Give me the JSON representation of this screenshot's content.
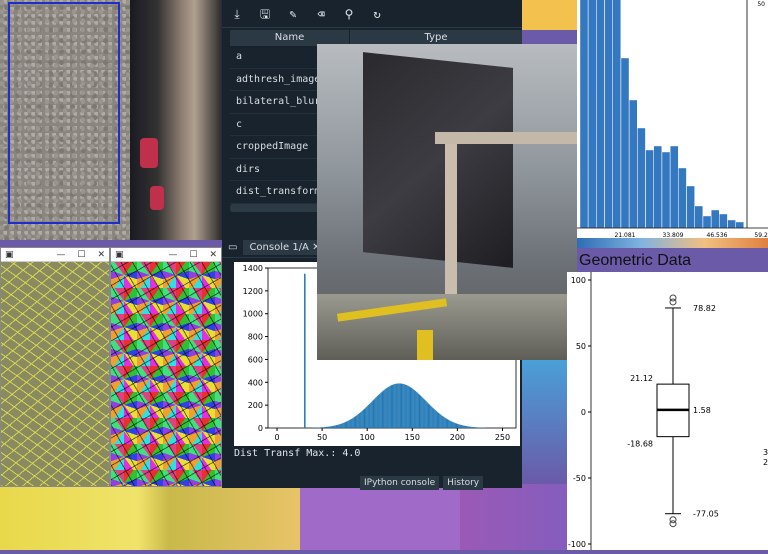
{
  "spyder": {
    "variable_explorer": {
      "col_name": "Name",
      "col_type": "Type",
      "rows": [
        "a",
        "adthresh_image",
        "bilateral_blur_",
        "c",
        "croppedImage",
        "dirs",
        "dist_transform"
      ]
    },
    "console_tab": "Console 1/A",
    "dist_text": "Dist Transf Max.:  4.0",
    "bottom_tabs": [
      "IPython console",
      "History"
    ]
  },
  "console_hist": {
    "type": "bar",
    "ytick_labels": [
      "1400",
      "1200",
      "1000",
      "800",
      "600",
      "400",
      "200",
      "0"
    ],
    "xtick_labels": [
      "0",
      "50",
      "100",
      "150",
      "200",
      "250"
    ],
    "spike_x": 30,
    "spike_y": 1350,
    "xlim": [
      -10,
      265
    ],
    "ylim": [
      0,
      1400
    ]
  },
  "right_hist": {
    "xtick_labels": [
      "21.081",
      "33.809",
      "46.536",
      "59.26"
    ],
    "right_tick": "50"
  },
  "geometric": {
    "title": "Geometric Data",
    "ytick_labels": [
      "100",
      "50",
      "0",
      "-50",
      "-100"
    ],
    "annotations": {
      "upper_whisker": "78.82",
      "q3": "21.12",
      "median": "1.58",
      "q1": "-18.68",
      "lower_whisker": "-77.05"
    },
    "clipped_right": [
      "3",
      "2"
    ]
  },
  "colors": {
    "spyder_bg": "#19232d",
    "hist_blue": "#1f77b4",
    "roi_blue": "#1e2ecc"
  }
}
